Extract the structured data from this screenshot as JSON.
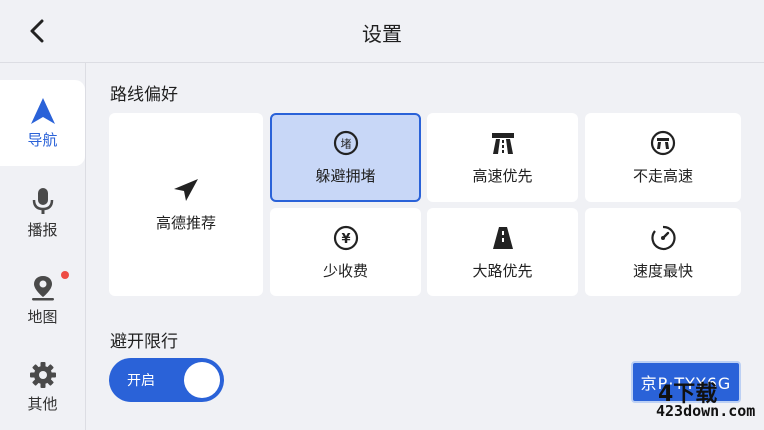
{
  "header": {
    "title": "设置"
  },
  "sidebar": {
    "items": [
      {
        "label": "导航",
        "icon": "navigation-arrow-icon",
        "active": true
      },
      {
        "label": "播报",
        "icon": "microphone-icon",
        "active": false
      },
      {
        "label": "地图",
        "icon": "map-pin-icon",
        "active": false,
        "badge": true
      },
      {
        "label": "其他",
        "icon": "gear-icon",
        "active": false
      }
    ]
  },
  "route": {
    "title": "路线偏好",
    "options": [
      {
        "label": "高德推荐",
        "icon": "paper-plane-icon",
        "selected": false
      },
      {
        "label": "躲避拥堵",
        "icon": "avoid-congestion-icon",
        "icon_text": "堵",
        "selected": true
      },
      {
        "label": "高速优先",
        "icon": "highway-icon",
        "selected": false
      },
      {
        "label": "不走高速",
        "icon": "no-highway-icon",
        "selected": false
      },
      {
        "label": "少收费",
        "icon": "yuan-coin-icon",
        "icon_text": "¥",
        "selected": false
      },
      {
        "label": "大路优先",
        "icon": "main-road-icon",
        "selected": false
      },
      {
        "label": "速度最快",
        "icon": "speedometer-icon",
        "selected": false
      }
    ]
  },
  "restriction": {
    "title": "避开限行",
    "toggle_label": "开启",
    "toggle_on": true,
    "plate": "京P·TYY6G"
  },
  "watermark": {
    "logo": "4下载",
    "site": "423down.com"
  },
  "colors": {
    "accent": "#2a62d8",
    "selected_bg": "#c8d7f7",
    "background": "#f0f1f5",
    "badge": "#ee4c44"
  }
}
